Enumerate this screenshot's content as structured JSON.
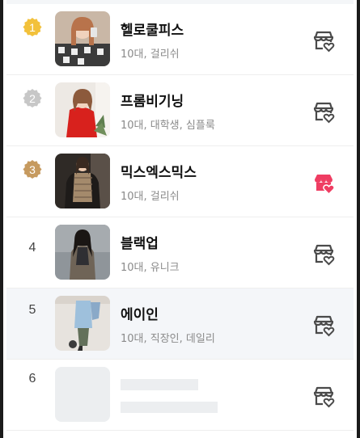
{
  "colors": {
    "gold": "#f2c13b",
    "silver": "#c7c7c7",
    "bronze": "#c69a5f",
    "favorite_active": "#ef3d62",
    "favorite_inactive": "#4a4a4a"
  },
  "shops": [
    {
      "rank": "1",
      "name": "헬로쿨피스",
      "tags": "10대, 걸리쉬",
      "favorited": false
    },
    {
      "rank": "2",
      "name": "프롬비기닝",
      "tags": "10대, 대학생, 심플룩",
      "favorited": false
    },
    {
      "rank": "3",
      "name": "믹스엑스믹스",
      "tags": "10대, 걸리쉬",
      "favorited": true
    },
    {
      "rank": "4",
      "name": "블랙업",
      "tags": "10대, 유니크",
      "favorited": false
    },
    {
      "rank": "5",
      "name": "에이인",
      "tags": "10대, 직장인, 데일리",
      "favorited": false
    },
    {
      "rank": "6",
      "loading": true,
      "favorited": false
    }
  ],
  "icons": {
    "favorite": "store-heart-icon",
    "medal": "medal-badge-icon"
  }
}
